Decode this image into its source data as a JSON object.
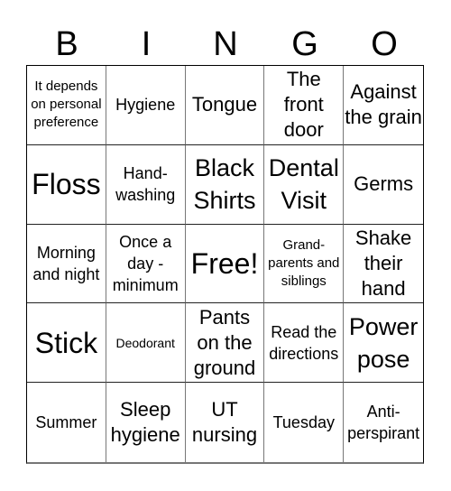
{
  "header": {
    "letters": [
      "B",
      "I",
      "N",
      "G",
      "O"
    ]
  },
  "cells": [
    {
      "text": "It depends on personal preference",
      "size": "s-sm"
    },
    {
      "text": "Hygiene",
      "size": "s-md"
    },
    {
      "text": "Tongue",
      "size": "s-lg"
    },
    {
      "text": "The front door",
      "size": "s-lg"
    },
    {
      "text": "Against the grain",
      "size": "s-lg"
    },
    {
      "text": "Floss",
      "size": "s-xxl"
    },
    {
      "text": "Hand-washing",
      "size": "s-md"
    },
    {
      "text": "Black Shirts",
      "size": "s-xl"
    },
    {
      "text": "Dental Visit",
      "size": "s-xl"
    },
    {
      "text": "Germs",
      "size": "s-lg"
    },
    {
      "text": "Morning and night",
      "size": "s-md"
    },
    {
      "text": "Once a day - minimum",
      "size": "s-md"
    },
    {
      "text": "Free!",
      "size": "s-xxl"
    },
    {
      "text": "Grand-parents and siblings",
      "size": "s-sm"
    },
    {
      "text": "Shake their hand",
      "size": "s-lg"
    },
    {
      "text": "Stick",
      "size": "s-xxl"
    },
    {
      "text": "Deodorant",
      "size": "s-xs"
    },
    {
      "text": "Pants on the ground",
      "size": "s-lg"
    },
    {
      "text": "Read the directions",
      "size": "s-md"
    },
    {
      "text": "Power pose",
      "size": "s-xl"
    },
    {
      "text": "Summer",
      "size": "s-md"
    },
    {
      "text": "Sleep hygiene",
      "size": "s-lg"
    },
    {
      "text": "UT nursing",
      "size": "s-lg"
    },
    {
      "text": "Tuesday",
      "size": "s-md"
    },
    {
      "text": "Anti-perspirant",
      "size": "s-md"
    }
  ]
}
